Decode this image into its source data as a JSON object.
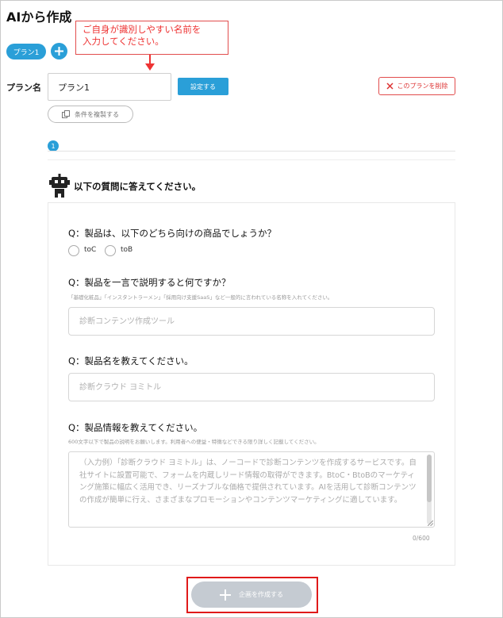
{
  "page": {
    "title": "AIから作成"
  },
  "plan_tabs": [
    {
      "label": "プラン1"
    }
  ],
  "callout": {
    "line1": "ご自身が識別しやすい名前を",
    "line2": "入力してください。"
  },
  "plan_name": {
    "label": "プラン名",
    "value": "プラン1"
  },
  "buttons": {
    "set": "設定する",
    "delete": "このプランを削除",
    "copy": "条件を複製する",
    "create": "企画を作成する"
  },
  "step": {
    "number": "1"
  },
  "intro": {
    "text": "以下の質問に答えてください。"
  },
  "questions": {
    "q1": {
      "text": "Q：製品は、以下のどちら向けの商品でしょうか？",
      "options": [
        "toC",
        "toB"
      ]
    },
    "q2": {
      "text": "Q：製品を一言で説明すると何ですか？",
      "hint": "「基礎化粧品」「インスタントラーメン」「採用向け支援SaaS」など一般的に言われている名称を入れてください。",
      "placeholder": "診断コンテンツ作成ツール"
    },
    "q3": {
      "text": "Q：製品名を教えてください。",
      "placeholder": "診断クラウド ヨミトル"
    },
    "q4": {
      "text": "Q：製品情報を教えてください。",
      "hint": "600文字以下で製品の説明をお願いします。利用者への便益・特徴などできる限り詳しく記載してください。",
      "placeholder": "（入力例）「診断クラウド ヨミトル」は、ノーコードで診断コンテンツを作成するサービスです。自社サイトに設置可能で、フォームを内蔵しリード情報の取得ができます。BtoC・BtoBのマーケティング施策に幅広く活用でき、リーズナブルな価格で提供されています。AIを活用して診断コンテンツの作成が簡単に行え、さまざまなプロモーションやコンテンツマーケティングに適しています。",
      "counter": "0/600"
    }
  },
  "colors": {
    "accent": "#2a9fd8",
    "danger": "#e24d4d",
    "disabled": "#c5cbd2"
  }
}
